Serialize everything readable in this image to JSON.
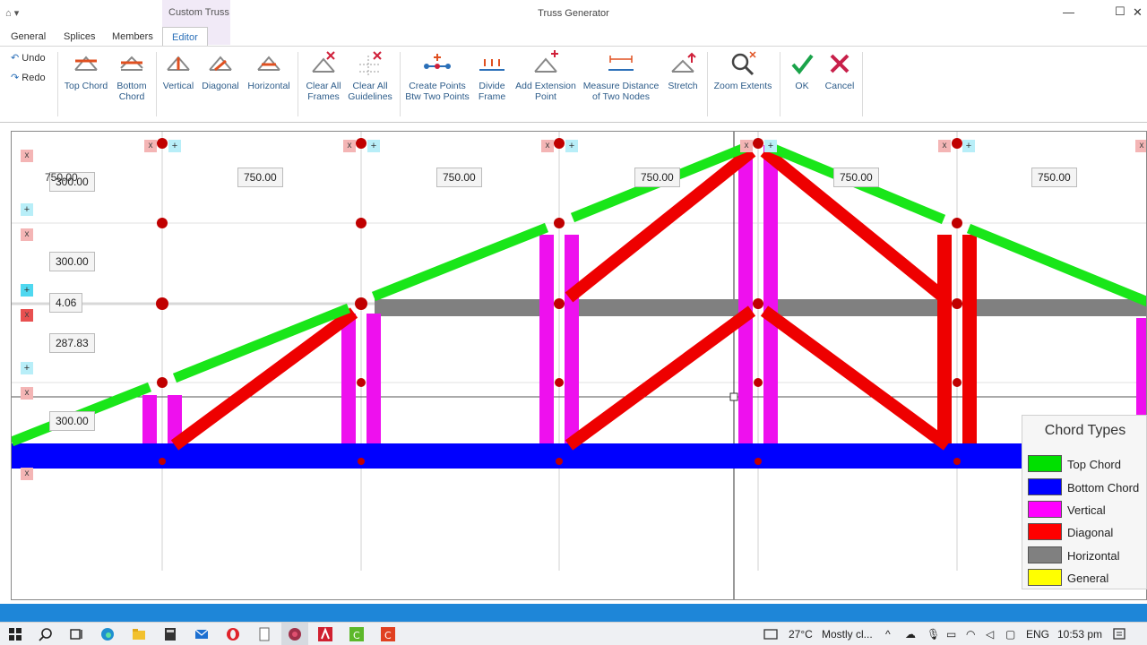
{
  "window": {
    "title": "Truss Generator",
    "context_tab": "Custom Truss",
    "minimize": "—",
    "maximize": "☐",
    "close": "✕"
  },
  "tabs": [
    "General",
    "Splices",
    "Members",
    "Editor"
  ],
  "active_tab": "Editor",
  "ribbon": {
    "undo": "Undo",
    "redo": "Redo",
    "buttons": [
      {
        "id": "top-chord",
        "line1": "Top Chord",
        "line2": ""
      },
      {
        "id": "bottom-chord",
        "line1": "Bottom",
        "line2": "Chord"
      },
      {
        "id": "vertical",
        "line1": "Vertical",
        "line2": ""
      },
      {
        "id": "diagonal",
        "line1": "Diagonal",
        "line2": ""
      },
      {
        "id": "horizontal",
        "line1": "Horizontal",
        "line2": ""
      },
      {
        "id": "clear-all-frames",
        "line1": "Clear All",
        "line2": "Frames"
      },
      {
        "id": "clear-all-guidelines",
        "line1": "Clear All",
        "line2": "Guidelines"
      },
      {
        "id": "create-points",
        "line1": "Create Points",
        "line2": "Btw Two Points"
      },
      {
        "id": "divide-frame",
        "line1": "Divide",
        "line2": "Frame"
      },
      {
        "id": "add-extension-point",
        "line1": "Add Extension",
        "line2": "Point"
      },
      {
        "id": "measure-distance",
        "line1": "Measure Distance",
        "line2": "of Two Nodes"
      },
      {
        "id": "stretch",
        "line1": "Stretch",
        "line2": ""
      },
      {
        "id": "zoom-extents",
        "line1": "Zoom Extents",
        "line2": ""
      },
      {
        "id": "ok",
        "line1": "OK",
        "line2": ""
      },
      {
        "id": "cancel",
        "line1": "Cancel",
        "line2": ""
      }
    ]
  },
  "canvas": {
    "span_labels": [
      "750.00",
      "750.00",
      "750.00",
      "750.00",
      "750.00",
      "750.00"
    ],
    "overlap_label": "300.00",
    "height_labels": [
      "300.00",
      "4.06",
      "287.83",
      "300.00"
    ],
    "control_x": "x",
    "control_plus": "+"
  },
  "legend": {
    "title": "Chord Types",
    "items": [
      {
        "label": "Top Chord",
        "color": "#00e000"
      },
      {
        "label": "Bottom Chord",
        "color": "#0000ff"
      },
      {
        "label": "Vertical",
        "color": "#ff00ff"
      },
      {
        "label": "Diagonal",
        "color": "#ff0000"
      },
      {
        "label": "Horizontal",
        "color": "#808080"
      },
      {
        "label": "General",
        "color": "#ffff00"
      }
    ]
  },
  "member_colors": {
    "top_chord": "#19e619",
    "bottom_chord": "#0000ff",
    "vertical": "#ee10ee",
    "diagonal": "#ee0000",
    "horizontal": "#808080",
    "node": "#c00000"
  },
  "taskbar": {
    "weather_temp": "27°C",
    "weather_text": "Mostly cl...",
    "language": "ENG",
    "time": "10:53 pm"
  }
}
